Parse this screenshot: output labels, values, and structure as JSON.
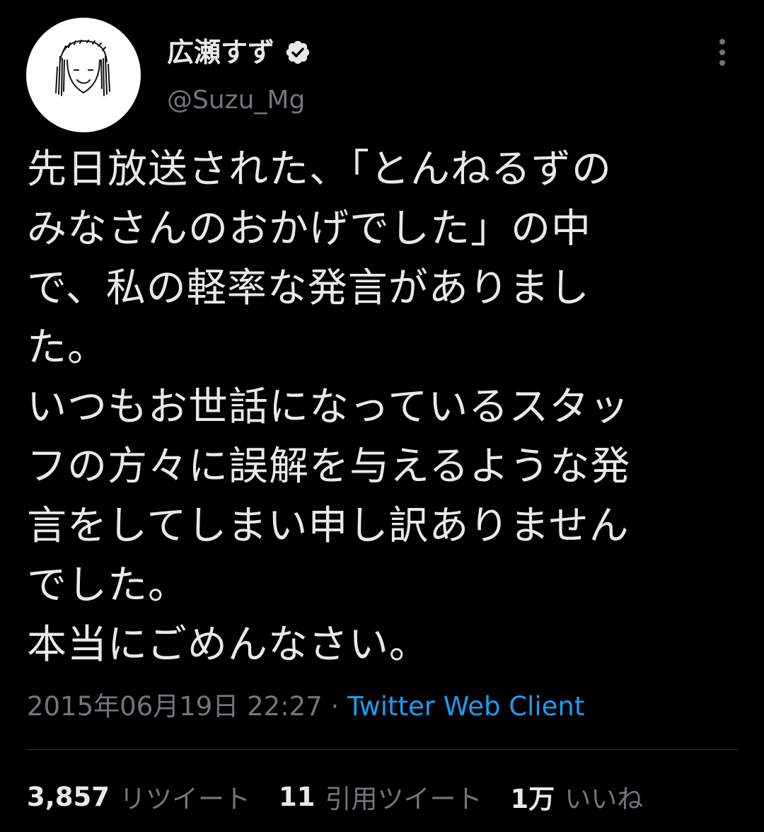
{
  "author": {
    "display_name": "広瀬すず",
    "handle": "@Suzu_Mg",
    "verified": true,
    "avatar_icon": "hand-drawn-self-portrait-avatar"
  },
  "menu": {
    "icon": "more-vertical-icon"
  },
  "tweet": {
    "lines": [
      "先日放送された、「とんねるずの",
      "みなさんのおかげでした」の中",
      "で、私の軽率な発言がありまし",
      "た。",
      "いつもお世話になっているスタッ",
      "フの方々に誤解を与えるような発",
      "言をしてしまい申し訳ありません",
      "でした。",
      "本当にごめんなさい。"
    ],
    "timestamp": "2015年06月19日 22:27",
    "separator": " · ",
    "source": "Twitter Web Client"
  },
  "stats": {
    "retweets_count": "3,857",
    "retweets_label": "リツイート",
    "quotes_count": "11",
    "quotes_label": "引用ツイート",
    "likes_count": "1万",
    "likes_label": "いいね"
  },
  "colors": {
    "background": "#000000",
    "text_primary": "#e7e9ea",
    "text_secondary": "#71767b",
    "link": "#1d9bf0",
    "divider": "#2f3336"
  }
}
